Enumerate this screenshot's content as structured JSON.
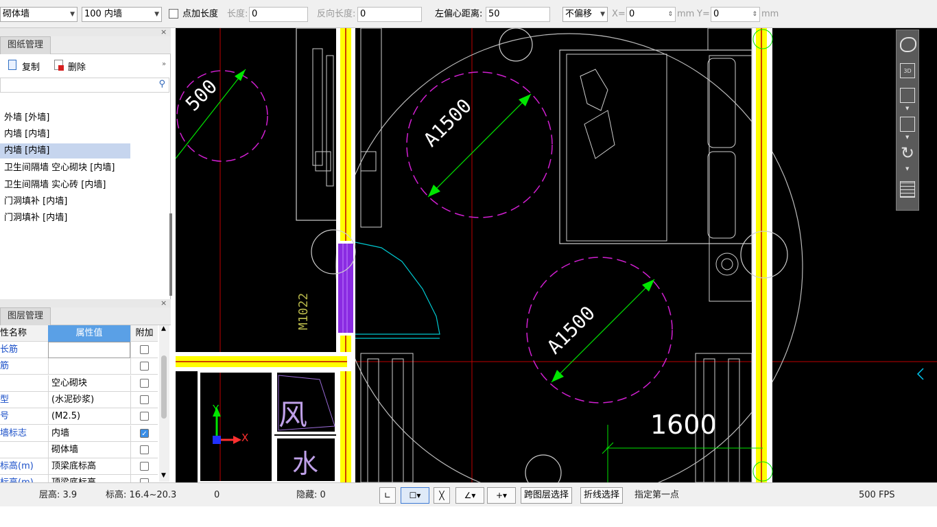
{
  "toolbar": {
    "wall_type": "砌体墙",
    "wall_spec": "100 内墙",
    "add_length_label": "点加长度",
    "length_label": "长度:",
    "length_value": "0",
    "reverse_length_label": "反向长度:",
    "reverse_length_value": "0",
    "left_offset_label": "左偏心距离:",
    "left_offset_value": "50",
    "offset_mode": "不偏移",
    "x_label": "X=",
    "x_value": "0",
    "x_unit": "mm",
    "y_label": "Y=",
    "y_value": "0",
    "y_unit": "mm"
  },
  "drawing_panel": {
    "title": "图纸管理",
    "copy_label": "复制",
    "delete_label": "删除",
    "items": [
      {
        "label": "外墙 [外墙]"
      },
      {
        "label": "内墙 [内墙]"
      },
      {
        "label": "内墙 [内墙]"
      },
      {
        "label": "卫生间隔墙 空心砌块 [内墙]"
      },
      {
        "label": "卫生间隔墙 实心砖 [内墙]"
      },
      {
        "label": "门洞填补 [内墙]"
      },
      {
        "label": "门洞填补 [内墙]"
      }
    ]
  },
  "layer_panel": {
    "title": "图层管理",
    "col_name": "性名称",
    "col_value": "属性值",
    "col_add": "附加",
    "rows": [
      {
        "name": "长筋",
        "value": "",
        "checked": false
      },
      {
        "name": "筋",
        "value": "",
        "checked": false
      },
      {
        "name": "",
        "value": "空心砌块",
        "checked": false
      },
      {
        "name": "型",
        "value": "(水泥砂浆)",
        "checked": false
      },
      {
        "name": "号",
        "value": "(M2.5)",
        "checked": false
      },
      {
        "name": "墙标志",
        "value": "内墙",
        "checked": true
      },
      {
        "name": "",
        "value": "砌体墙",
        "checked": false
      },
      {
        "name": "标高(m)",
        "value": "顶梁底标高",
        "checked": false
      },
      {
        "name": "标高(m)",
        "value": "顶梁底标高",
        "checked": false
      }
    ]
  },
  "canvas": {
    "dim_a1500_1": "A1500",
    "dim_a1500_2": "A1500",
    "dim_partial": "500",
    "door_label": "M1022",
    "dim_1600": "1600",
    "room_wind": "风",
    "room_water": "水",
    "axis_x": "X",
    "axis_y": "Y"
  },
  "statusbar": {
    "floor_height": "层高:  3.9",
    "elevation": "标高:  16.4~20.3",
    "zero": "0",
    "hidden": "隐藏:  0",
    "cross_layer": "跨图层选择",
    "polyline": "折线选择",
    "prompt": "指定第一点",
    "fps": "500 FPS"
  },
  "colors": {
    "wall_yellow": "#ffff00",
    "wall_white": "#ffffff",
    "axis_red": "#c00000",
    "magenta": "#d21fd2",
    "green": "#00e600",
    "door_purple": "#8a2be2",
    "cyan": "#00c8d0"
  }
}
